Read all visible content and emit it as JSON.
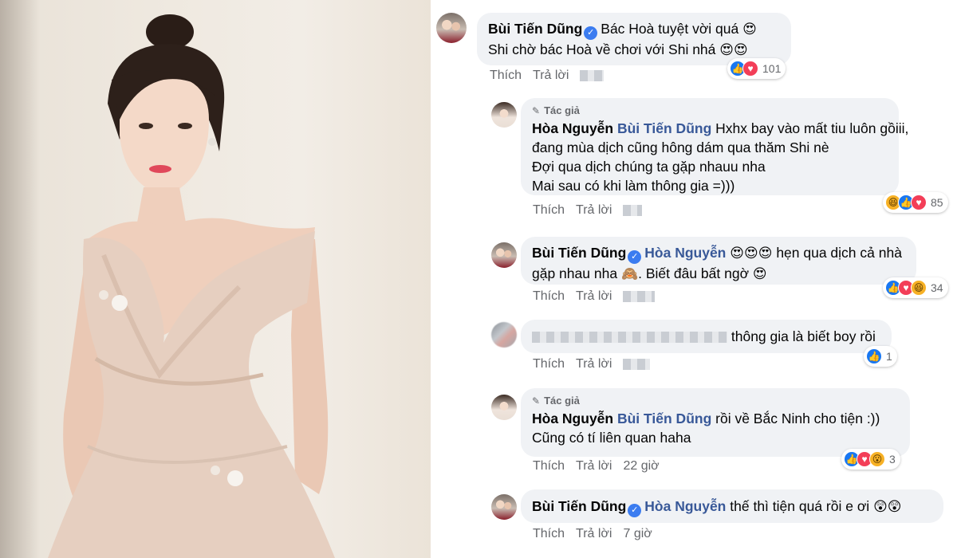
{
  "actions": {
    "like": "Thích",
    "reply": "Trả lời"
  },
  "author_tag": "Tác giả",
  "comments": [
    {
      "author": "Bùi Tiến Dũng",
      "verified": true,
      "lines": [
        "Bác Hoà tuyệt vời quá",
        "Shi chờ bác Hoà về chơi với Shi nhá"
      ],
      "emojis": [
        "😍",
        "😍😍"
      ],
      "time": "",
      "reactions": [
        "like",
        "love"
      ],
      "reaction_count": "101"
    },
    {
      "author": "Hòa Nguyễn",
      "mention": "Bùi Tiến Dũng",
      "is_author": true,
      "lines": [
        "Hxhx bay vào mất tiu luôn gồiii,",
        "đang mùa dịch cũng hông dám qua thăm Shi nè",
        "Đợi qua dịch chúng ta gặp nhauu nha",
        "Mai sau có khi làm thông gia =)))"
      ],
      "time": "",
      "reactions": [
        "haha",
        "like",
        "love"
      ],
      "reaction_count": "85"
    },
    {
      "author": "Bùi Tiến Dũng",
      "verified": true,
      "mention": "Hòa Nguyễn",
      "lines": [
        "hẹn qua dịch cả nhà",
        "gặp nhau nha",
        ". Biết đâu bất ngờ"
      ],
      "emojis": [
        "😍😍😍",
        "🙈",
        "😍"
      ],
      "time": "",
      "reactions": [
        "like",
        "love",
        "haha"
      ],
      "reaction_count": "34"
    },
    {
      "author": "",
      "lines": [
        "thông gia là biết boy rồi"
      ],
      "time": "",
      "reactions": [
        "like"
      ],
      "reaction_count": "1"
    },
    {
      "author": "Hòa Nguyễn",
      "mention": "Bùi Tiến Dũng",
      "is_author": true,
      "lines": [
        "rồi về Bắc Ninh cho tiện :))",
        "Cũng có tí liên quan haha"
      ],
      "time": "22 giờ",
      "reactions": [
        "like",
        "love",
        "wow"
      ],
      "reaction_count": "3"
    },
    {
      "author": "Bùi Tiến Dũng",
      "verified": true,
      "mention": "Hòa Nguyễn",
      "lines": [
        "thế thì tiện quá rồi e ơi"
      ],
      "emojis": [
        "😲😲"
      ],
      "time": "7 giờ",
      "reactions": [],
      "reaction_count": ""
    }
  ],
  "colors": {
    "bubble": "#f0f2f5",
    "mention": "#385898",
    "like": "#1877f2",
    "love": "#f33e58",
    "haha": "#f7b125",
    "meta": "#65676b"
  },
  "icons": {
    "verified": "verified-badge-icon",
    "pen": "pen-icon",
    "like": "like-reaction-icon",
    "love": "love-reaction-icon",
    "haha": "haha-reaction-icon",
    "wow": "wow-reaction-icon"
  }
}
